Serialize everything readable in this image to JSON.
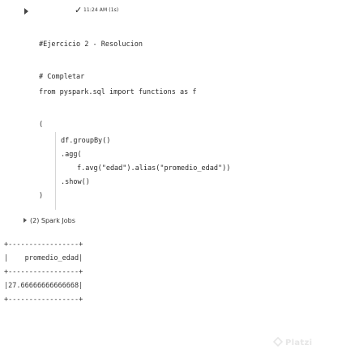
{
  "toolbar": {
    "status_icon": "check-icon",
    "status_text": "11:24 AM (1s)"
  },
  "code": {
    "lines": [
      "#Ejercicio 2 - Resolucion",
      "# Completar",
      "from pyspark.sql import functions as f",
      "(",
      "df.groupBy()",
      ".agg(",
      "f.avg(\"edad\").alias(\"promedio_edad\"))",
      ".show()",
      ")"
    ]
  },
  "spark_jobs": {
    "label": "(2) Spark Jobs"
  },
  "output": {
    "lines": [
      "+-----------------+",
      "|    promedio_edad|",
      "+-----------------+",
      "|27.66666666666668|",
      "+-----------------+"
    ]
  },
  "watermark": {
    "text": "Platzi",
    "icon": "platzi-logo-icon"
  }
}
